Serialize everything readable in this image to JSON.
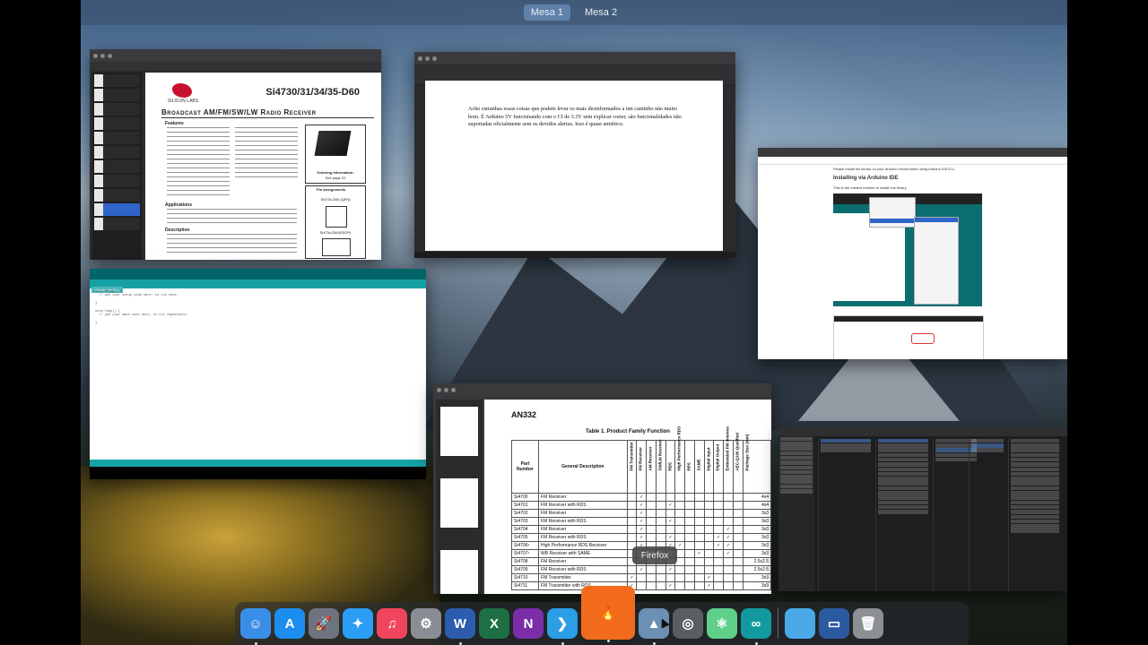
{
  "spaces": {
    "tabs": [
      "Mesa 1",
      "Mesa 2"
    ],
    "active": "Mesa 1"
  },
  "pdf_window": {
    "logo_text": "SILICON LABS",
    "title": "Si4730/31/34/35-D60",
    "subtitle": "Broadcast AM/FM/SW/LW Radio Receiver",
    "features_heading": "Features",
    "applications_heading": "Applications",
    "description_heading": "Description",
    "ordering_info": "Ordering Information:",
    "ordering_see": "See page 31",
    "pin_assignments": "Pin Assignments",
    "package_a": "Si473x-D60 (QFN)",
    "package_b": "Si473x-D60(SSOP)"
  },
  "doc_window": {
    "body_text": "Acho estranhas essas coisas que podem levar os mais desinformados a um caminho não muito bom. É Arduino 5V funcionando com o CI de 3.3V sem explicar como; são funcionalidades não suportadas oficialmente sem os devidos alertas. Isso é quase antiético."
  },
  "arduino_window": {
    "tab_name": "sketch_dec11a",
    "code": "void setup() {\n  // put your setup code here, to run once:\n\n}\n\nvoid loop() {\n  // put your main code here, to run repeatedly:\n\n}"
  },
  "browser_window": {
    "intro": "Please install the library on your Arduino environment using Arduino IDE/CLI.",
    "heading": "Installing via Arduino IDE",
    "line": "This is the easiest method to install this library."
  },
  "an332_window": {
    "heading": "AN332",
    "table_caption": "Table 1. Product Family Function",
    "col_part": "Part Number",
    "col_desc": "General Description",
    "feature_cols": [
      "FM Transmitter",
      "FM Receiver",
      "AM Receiver",
      "SW/LW Receiver",
      "RDS",
      "High Performance RDS",
      "RPS",
      "SAME",
      "Digital Input",
      "Digital Output",
      "Embedded FM antenna",
      "AEC-Q100 Qualified"
    ],
    "col_size": "Package Size (mm)",
    "rows": [
      {
        "part": "Si4700",
        "desc": "FM Receiver",
        "checks": [
          0,
          1,
          0,
          0,
          0,
          0,
          0,
          0,
          0,
          0,
          0,
          0
        ],
        "size": "4x4"
      },
      {
        "part": "Si4701",
        "desc": "FM Receiver with RDS",
        "checks": [
          0,
          1,
          0,
          0,
          1,
          0,
          0,
          0,
          0,
          0,
          0,
          0
        ],
        "size": "4x4"
      },
      {
        "part": "Si4702",
        "desc": "FM Receiver",
        "checks": [
          0,
          1,
          0,
          0,
          0,
          0,
          0,
          0,
          0,
          0,
          0,
          0
        ],
        "size": "3x3"
      },
      {
        "part": "Si4703",
        "desc": "FM Receiver with RDS",
        "checks": [
          0,
          1,
          0,
          0,
          1,
          0,
          0,
          0,
          0,
          0,
          0,
          0
        ],
        "size": "3x3"
      },
      {
        "part": "Si4704",
        "desc": "FM Receiver",
        "checks": [
          0,
          1,
          0,
          0,
          0,
          0,
          0,
          0,
          0,
          0,
          1,
          0
        ],
        "size": "3x3"
      },
      {
        "part": "Si4705",
        "desc": "FM Receiver with RDS",
        "checks": [
          0,
          1,
          0,
          0,
          1,
          0,
          0,
          0,
          0,
          1,
          1,
          0
        ],
        "size": "3x3"
      },
      {
        "part": "Si4706¹",
        "desc": "High Performance RDS Receiver",
        "checks": [
          0,
          1,
          0,
          0,
          1,
          1,
          0,
          0,
          0,
          1,
          1,
          0
        ],
        "size": "3x3"
      },
      {
        "part": "Si4707¹",
        "desc": "WB Receiver with SAME",
        "checks": [
          0,
          0,
          0,
          0,
          0,
          0,
          0,
          1,
          0,
          0,
          1,
          0
        ],
        "size": "3x3"
      },
      {
        "part": "Si4708",
        "desc": "FM Receiver",
        "checks": [
          0,
          1,
          0,
          0,
          0,
          0,
          0,
          0,
          0,
          0,
          0,
          0
        ],
        "size": "2.5x2.5"
      },
      {
        "part": "Si4709",
        "desc": "FM Receiver with RDS",
        "checks": [
          0,
          1,
          0,
          0,
          1,
          0,
          0,
          0,
          0,
          0,
          0,
          0
        ],
        "size": "2.5x2.5"
      },
      {
        "part": "Si4710",
        "desc": "FM Transmitter",
        "checks": [
          1,
          0,
          0,
          0,
          0,
          0,
          0,
          0,
          1,
          0,
          0,
          0
        ],
        "size": "3x3"
      },
      {
        "part": "Si4711",
        "desc": "FM Transmitter with RDS",
        "checks": [
          1,
          0,
          0,
          0,
          1,
          0,
          0,
          0,
          1,
          0,
          0,
          0
        ],
        "size": "3x3"
      }
    ]
  },
  "dock": {
    "tooltip": "Firefox",
    "items": [
      {
        "name": "finder-icon",
        "glyph": "☺",
        "color": "#3b8ee8",
        "running": true
      },
      {
        "name": "app-store-icon",
        "glyph": "A",
        "color": "#1c8ef0",
        "running": false
      },
      {
        "name": "launchpad-icon",
        "glyph": "🚀",
        "color": "#6e7380",
        "running": false
      },
      {
        "name": "safari-icon",
        "glyph": "✦",
        "color": "#2a9df4",
        "running": false
      },
      {
        "name": "music-icon",
        "glyph": "♫",
        "color": "#f1455e",
        "running": false
      },
      {
        "name": "system-preferences-icon",
        "glyph": "⚙",
        "color": "#8a8d93",
        "running": false
      },
      {
        "name": "word-icon",
        "glyph": "W",
        "color": "#2b5cad",
        "running": true
      },
      {
        "name": "excel-icon",
        "glyph": "X",
        "color": "#1d7044",
        "running": false
      },
      {
        "name": "onenote-icon",
        "glyph": "N",
        "color": "#7b2ea8",
        "running": false
      },
      {
        "name": "vscode-icon",
        "glyph": "❯",
        "color": "#2b9ee6",
        "running": true
      },
      {
        "name": "firefox-icon",
        "glyph": "🔥",
        "color": "#f26b1d",
        "running": true,
        "big": true
      },
      {
        "name": "preview-icon",
        "glyph": "▲",
        "color": "#6b8fb5",
        "running": true
      },
      {
        "name": "image-capture-icon",
        "glyph": "◎",
        "color": "#5a5d62",
        "running": false
      },
      {
        "name": "atom-icon",
        "glyph": "⚛",
        "color": "#5fcf8a",
        "running": false
      },
      {
        "name": "arduino-icon",
        "glyph": "∞",
        "color": "#139aa0",
        "running": true
      },
      {
        "name": "separator",
        "glyph": "",
        "color": "",
        "running": false
      },
      {
        "name": "folder-icon",
        "glyph": "",
        "color": "#4aa8e8",
        "running": false
      },
      {
        "name": "desktop-stack-icon",
        "glyph": "▭",
        "color": "#2c5aa0",
        "running": false
      },
      {
        "name": "trash-icon",
        "glyph": "🗑",
        "color": "#8c8f94",
        "running": false
      }
    ]
  }
}
